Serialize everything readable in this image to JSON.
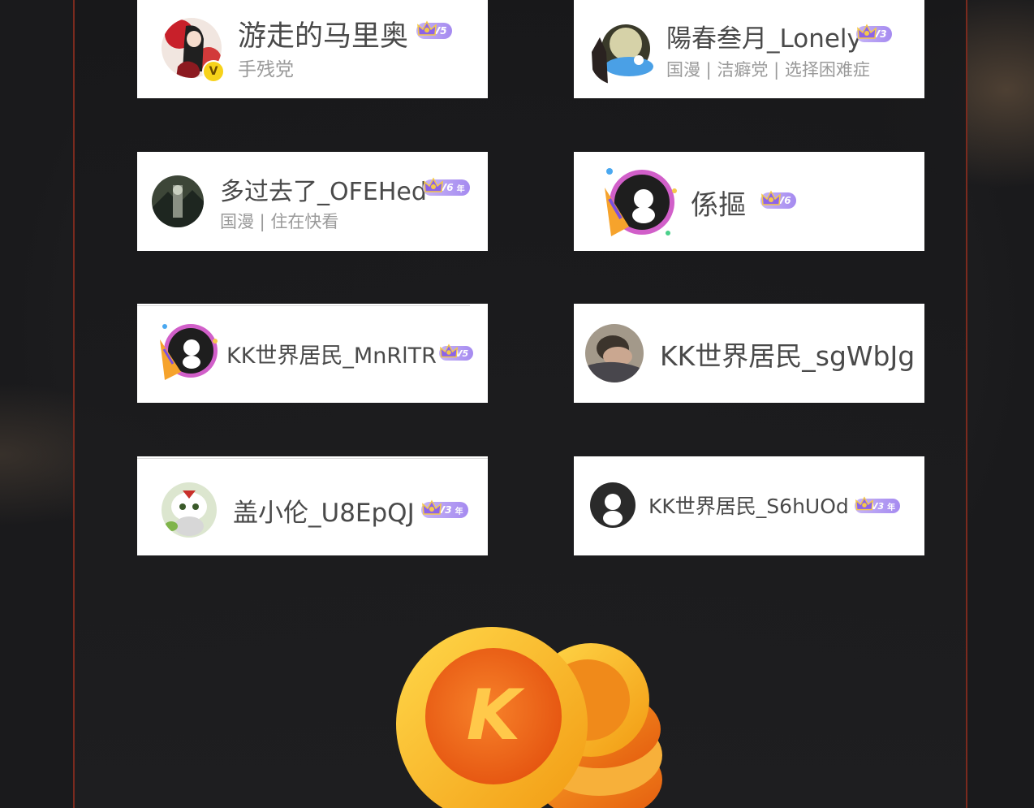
{
  "users": [
    {
      "name": "游走的马里奥",
      "tags": "手残党",
      "vip": "V5",
      "vip_year": ""
    },
    {
      "name": "陽春叁月_Lonely",
      "tags": "国漫 | 洁癖党 | 选择困难症",
      "vip": "V3",
      "vip_year": ""
    },
    {
      "name": "多过去了_OFEHed",
      "tags": "国漫 | 住在快看",
      "vip": "V6",
      "vip_year": "年"
    },
    {
      "name": "係摳",
      "tags": "",
      "vip": "V6",
      "vip_year": ""
    },
    {
      "name": "KK世界居民_MnRlTR",
      "tags": "",
      "vip": "V5",
      "vip_year": ""
    },
    {
      "name": "KK世界居民_sgWbJg",
      "tags": "",
      "vip": "",
      "vip_year": ""
    },
    {
      "name": "盖小伦_U8EpQJ",
      "tags": "",
      "vip": "V3",
      "vip_year": "年"
    },
    {
      "name": "KK世界居民_S6hUOd",
      "tags": "",
      "vip": "V3",
      "vip_year": "年"
    }
  ],
  "verified_badge": "V",
  "coin_letter": "K",
  "colors": {
    "frame_border": "#7a2a1e",
    "vip_purple": "#a58af0",
    "coin_gold": "#f6b21c",
    "coin_orange": "#ef6a12"
  }
}
